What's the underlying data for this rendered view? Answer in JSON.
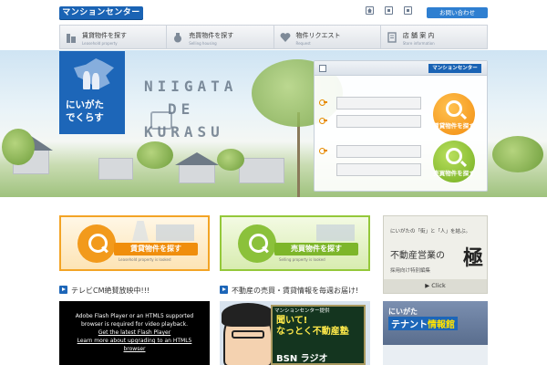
{
  "header": {
    "logo_text": "マンションセンター",
    "contact_label": "お問い合わせ",
    "icons": [
      "home-icon",
      "square-icon",
      "square-icon"
    ]
  },
  "nav": {
    "items": [
      {
        "label": "賃貸物件を探す",
        "sub": "Leasehold property",
        "icon": "building-icon"
      },
      {
        "label": "売買物件を探す",
        "sub": "Selling housing",
        "icon": "money-bag-icon"
      },
      {
        "label": "物件リクエスト",
        "sub": "Request",
        "icon": "heart-icon"
      },
      {
        "label": "店 舗 案 内",
        "sub": "Store information",
        "icon": "document-icon"
      }
    ]
  },
  "hero": {
    "blue_box_line1": "にいがた",
    "blue_box_line2": "でくらす",
    "title_line1": "NIIGATA",
    "title_line2": "DE",
    "title_line3": "KURASU"
  },
  "search_panel": {
    "logo_text": "マンションセンター",
    "rent_button": "賃貸物件を探す",
    "sale_button": "売買物件を探す"
  },
  "cards": {
    "rent": {
      "label": "賃貸物件を探す",
      "sub": "Leasehold property is looked"
    },
    "sale": {
      "label": "売買物件を探す",
      "sub": "Selling property is looked"
    }
  },
  "banner": {
    "line1": "にいがたの「街」と「人」を結ぶ。",
    "line2": "不動産営業の",
    "kanji": "極",
    "line3": "採用向け特別編集",
    "click": "▶ Click"
  },
  "sections": {
    "tv": "テレビCM絶賛放映中!!!",
    "news": "不動産の売買・賃貸情報を毎週お届け!"
  },
  "flash": {
    "line1": "Adobe Flash Player or an HTML5 supported",
    "line2": "browser is required for video playback.",
    "link1": "Get the latest Flash Player",
    "link2": "Learn more about upgrading to an HTML5",
    "link3": "browser"
  },
  "ad": {
    "provider": "マンションセンター提供",
    "line1": "聞いて!",
    "line2": "なっとく不動産塾",
    "radio": "BSN ラジオ"
  },
  "tenant": {
    "line1": "にいがた",
    "line2a": "テナント",
    "line2b": "情報館"
  }
}
